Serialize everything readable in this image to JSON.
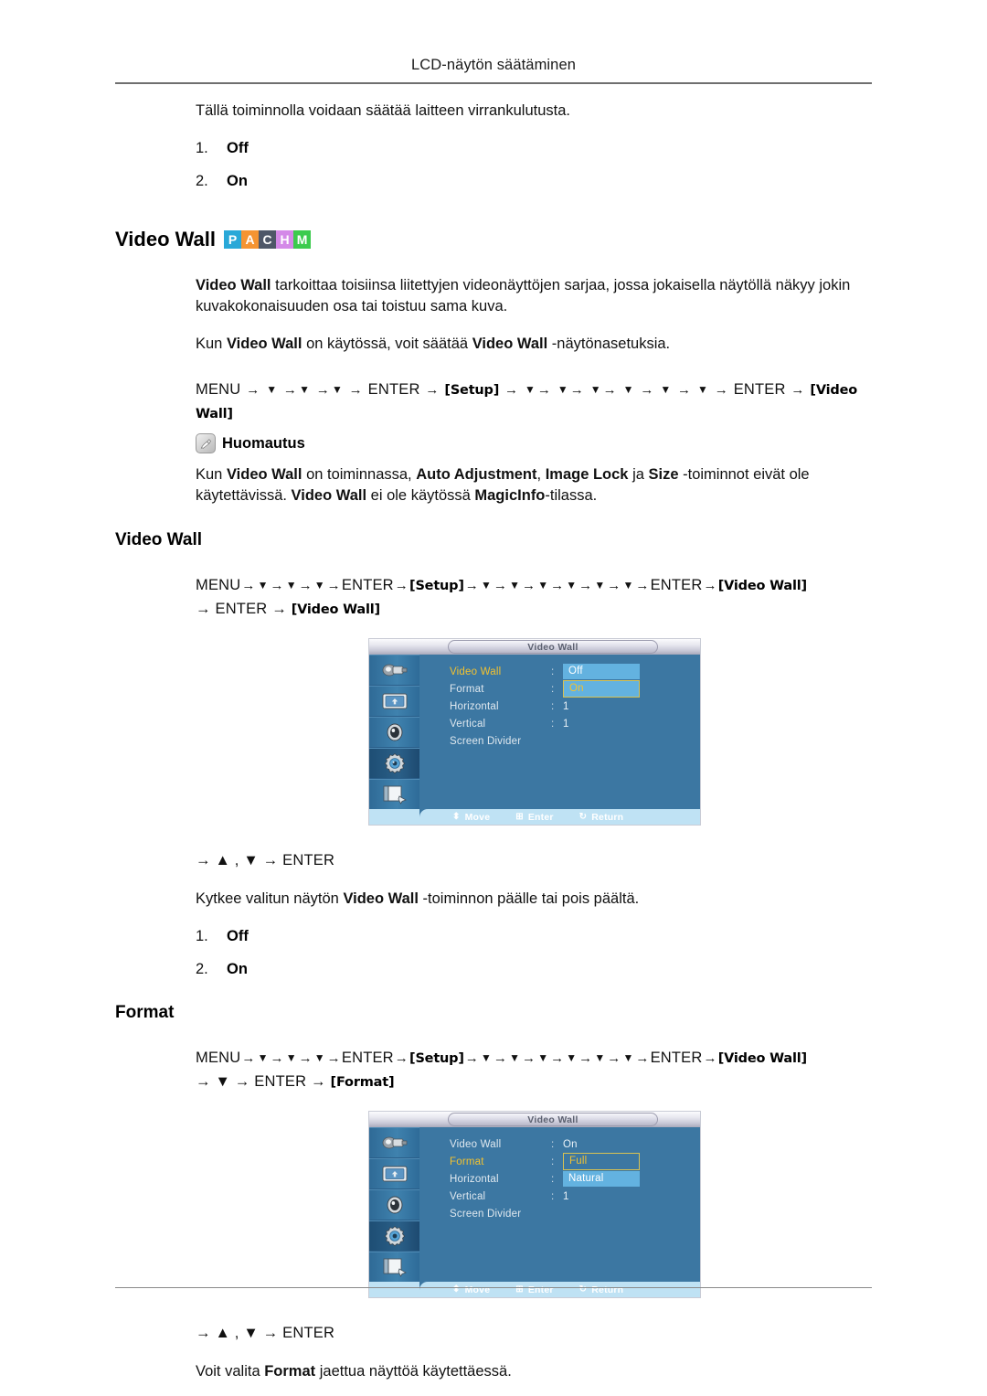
{
  "header": {
    "title": "LCD-näytön säätäminen"
  },
  "intro": {
    "paragraph": "Tällä toiminnolla voidaan säätää laitteen virrankulutusta.",
    "options": [
      {
        "num": "1.",
        "label": "Off"
      },
      {
        "num": "2.",
        "label": "On"
      }
    ]
  },
  "section_video_wall": {
    "heading": "Video Wall",
    "badges": [
      {
        "letter": "P",
        "color": "#29a8d8"
      },
      {
        "letter": "A",
        "color": "#f59432"
      },
      {
        "letter": "C",
        "color": "#4e5768"
      },
      {
        "letter": "H",
        "color": "#d489e8"
      },
      {
        "letter": "M",
        "color": "#3ccb4e"
      }
    ],
    "desc_bold_1": "Video Wall",
    "desc_rest_1": " tarkoittaa toisiinsa liitettyjen videonäyttöjen sarjaa, jossa jokaisella näytöllä näkyy jokin kuvakokonaisuuden osa tai toistuu sama kuva.",
    "desc_2_pre": "Kun ",
    "desc_2_b1": "Video Wall",
    "desc_2_mid": " on käytössä, voit säätää ",
    "desc_2_b2": "Video Wall",
    "desc_2_post": " -näytönasetuksia.",
    "menupath": {
      "menu": "MENU",
      "enter": "ENTER",
      "setup_btn": "Setup",
      "videowall_btn": "Video Wall"
    },
    "note": {
      "label": "Huomautus",
      "text_pre": "Kun ",
      "b1": "Video Wall",
      "t1": " on toiminnassa, ",
      "b2": "Auto Adjustment",
      "t2": ", ",
      "b3": "Image Lock",
      "t3": " ja ",
      "b4": "Size",
      "t4": " -toiminnot eivät ole käytettävissä. ",
      "b5": "Video Wall",
      "t5": " ei ole käytössä ",
      "b6": "MagicInfo",
      "t6": "-tilassa."
    }
  },
  "sub_video_wall": {
    "heading": "Video Wall",
    "path_line1_tokens": [
      "MENU",
      "ENTER",
      "Setup",
      "ENTER",
      "Video Wall"
    ],
    "path_line2": "→ ENTER →",
    "path_line2_btn": "Video Wall",
    "after_path": "→ ▲ , ▼ → ENTER",
    "desc_pre": "Kytkee valitun näytön ",
    "desc_bold": "Video Wall",
    "desc_post": " -toiminnon päälle tai pois päältä.",
    "options": [
      {
        "num": "1.",
        "label": "Off"
      },
      {
        "num": "2.",
        "label": "On"
      }
    ],
    "osd": {
      "title": "Video Wall",
      "rows": [
        {
          "label": "Video Wall",
          "selected": true,
          "colon": ":",
          "value": "",
          "value_style": "list"
        },
        {
          "label": "Format",
          "selected": false,
          "colon": ":",
          "value": "",
          "value_style": "list"
        },
        {
          "label": "Horizontal",
          "selected": false,
          "colon": ":",
          "value": "1",
          "value_style": "plain"
        },
        {
          "label": "Vertical",
          "selected": false,
          "colon": ":",
          "value": "1",
          "value_style": "plain"
        },
        {
          "label": "Screen Divider",
          "selected": false,
          "colon": "",
          "value": "",
          "value_style": "none"
        }
      ],
      "dropdown": [
        {
          "text": "Off",
          "style": "band"
        },
        {
          "text": "On",
          "style": "outline"
        }
      ],
      "footer": [
        {
          "glyph": "⬍",
          "label": "Move"
        },
        {
          "glyph": "⊞",
          "label": "Enter"
        },
        {
          "glyph": "↻",
          "label": "Return"
        }
      ],
      "sidebar_icons": [
        "input-source-icon",
        "picture-icon",
        "sound-icon",
        "setup-gear-icon",
        "multi-control-icon"
      ]
    }
  },
  "sub_format": {
    "heading": "Format",
    "path_line1_tokens": [
      "MENU",
      "ENTER",
      "Setup",
      "ENTER",
      "Video Wall"
    ],
    "path_line2_pre": "→ ▼ → ENTER →",
    "path_line2_btn": "Format",
    "after_path": "→ ▲ , ▼ → ENTER",
    "desc_pre": "Voit valita ",
    "desc_bold": "Format",
    "desc_post": " jaettua näyttöä käytettäessä.",
    "osd": {
      "title": "Video Wall",
      "rows": [
        {
          "label": "Video Wall",
          "selected": false,
          "colon": ":",
          "value": "On",
          "value_style": "plain"
        },
        {
          "label": "Format",
          "selected": true,
          "colon": ":",
          "value": "",
          "value_style": "list"
        },
        {
          "label": "Horizontal",
          "selected": false,
          "colon": ":",
          "value": "",
          "value_style": "list"
        },
        {
          "label": "Vertical",
          "selected": false,
          "colon": ":",
          "value": "1",
          "value_style": "plain"
        },
        {
          "label": "Screen Divider",
          "selected": false,
          "colon": "",
          "value": "",
          "value_style": "none"
        }
      ],
      "dropdown": [
        {
          "text": "Full",
          "style": "outline-on-dark"
        },
        {
          "text": "Natural",
          "style": "band"
        }
      ],
      "footer": [
        {
          "glyph": "⬍",
          "label": "Move"
        },
        {
          "glyph": "⊞",
          "label": "Enter"
        },
        {
          "glyph": "↻",
          "label": "Return"
        }
      ]
    }
  },
  "glyphs": {
    "arrow": "→",
    "down": "▼",
    "up": "▲",
    "comma": ","
  }
}
